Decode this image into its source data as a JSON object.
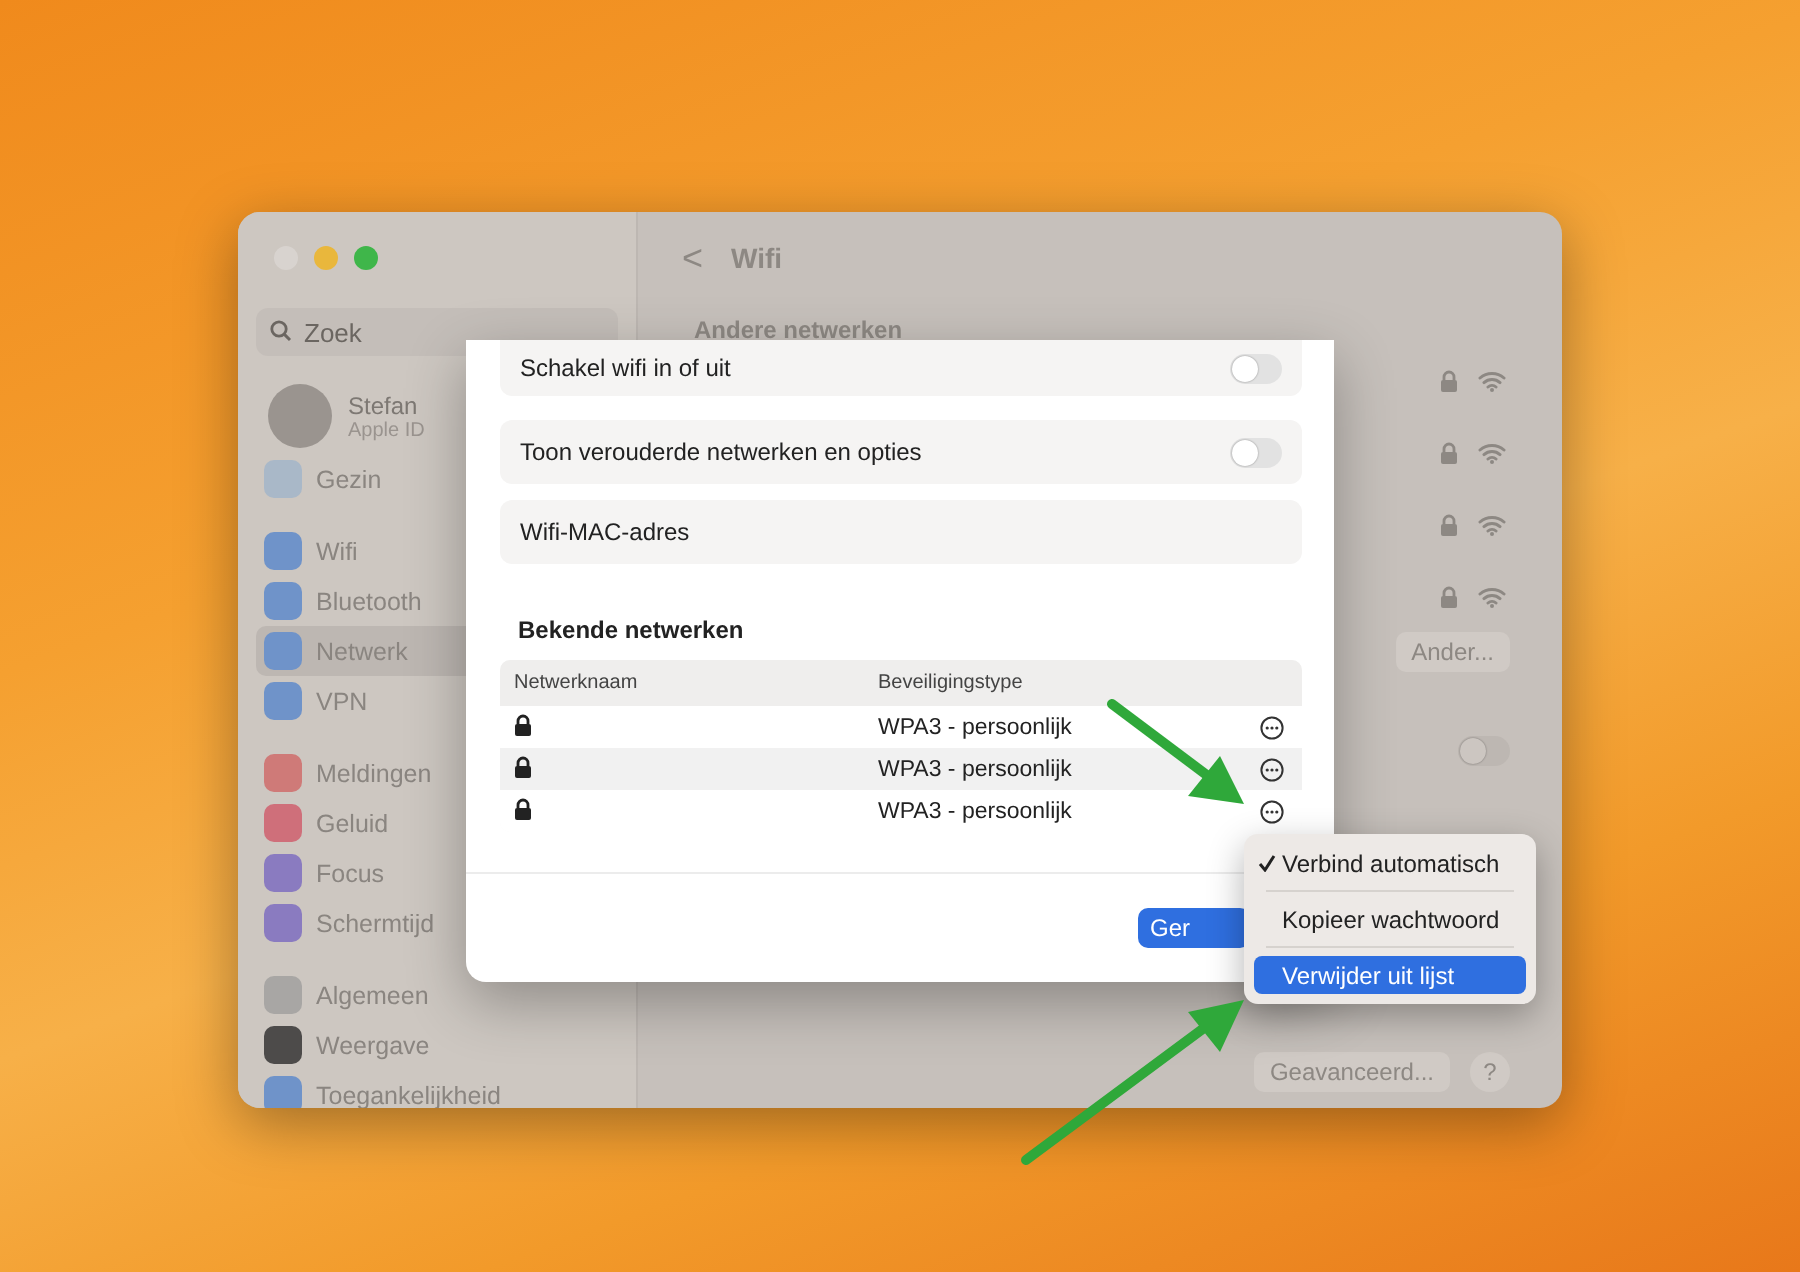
{
  "window": {
    "title": "Wifi",
    "back": "<"
  },
  "sidebar": {
    "search": {
      "placeholder": "Zoek"
    },
    "profile": {
      "name": "Stefan",
      "subtitle": "Apple ID"
    },
    "groups": [
      [
        {
          "label": "Gezin",
          "color": "#a9b8c8",
          "selected": false
        }
      ],
      [
        {
          "label": "Wifi",
          "color": "#6f93c9",
          "selected": false
        },
        {
          "label": "Bluetooth",
          "color": "#6f93c9",
          "selected": false
        },
        {
          "label": "Netwerk",
          "color": "#6f93c9",
          "selected": true
        },
        {
          "label": "VPN",
          "color": "#6f93c9",
          "selected": false
        }
      ],
      [
        {
          "label": "Meldingen",
          "color": "#cf7a78",
          "selected": false
        },
        {
          "label": "Geluid",
          "color": "#cf6f7a",
          "selected": false
        },
        {
          "label": "Focus",
          "color": "#8a7bc0",
          "selected": false
        },
        {
          "label": "Schermtijd",
          "color": "#8a7bc0",
          "selected": false
        }
      ],
      [
        {
          "label": "Algemeen",
          "color": "#a8a6a4",
          "selected": false
        },
        {
          "label": "Weergave",
          "color": "#4d4b4a",
          "selected": false
        },
        {
          "label": "Toegankelijkheid",
          "color": "#6f93c9",
          "selected": false
        }
      ]
    ]
  },
  "main": {
    "section": "Andere netwerken",
    "networks": [
      {
        "secured": true
      },
      {
        "secured": true
      },
      {
        "secured": true
      },
      {
        "secured": true
      }
    ],
    "other_button": "Ander...",
    "toggle_on": false,
    "advanced_button": "Geavanceerd...",
    "help_button": "?"
  },
  "dialog": {
    "settings": [
      {
        "kind": "toggle",
        "label": "Schakel wifi in of uit",
        "on": false
      },
      {
        "kind": "toggle",
        "label": "Toon verouderde netwerken en opties",
        "on": false
      },
      {
        "kind": "info",
        "label": "Wifi-MAC-adres"
      }
    ],
    "known_title": "Bekende netwerken",
    "table": {
      "columns": [
        "Netwerknaam",
        "Beveiligingstype"
      ],
      "rows": [
        {
          "security": "WPA3 - persoonlijk"
        },
        {
          "security": "WPA3 - persoonlijk"
        },
        {
          "security": "WPA3 - persoonlijk"
        }
      ]
    },
    "done_button": "Ger"
  },
  "menu": {
    "items": [
      {
        "label": "Verbind automatisch",
        "checked": true,
        "selected": false
      },
      {
        "label": "Kopieer wachtwoord",
        "checked": false,
        "selected": false
      },
      {
        "label": "Verwijder uit lijst",
        "checked": false,
        "selected": true
      }
    ]
  }
}
